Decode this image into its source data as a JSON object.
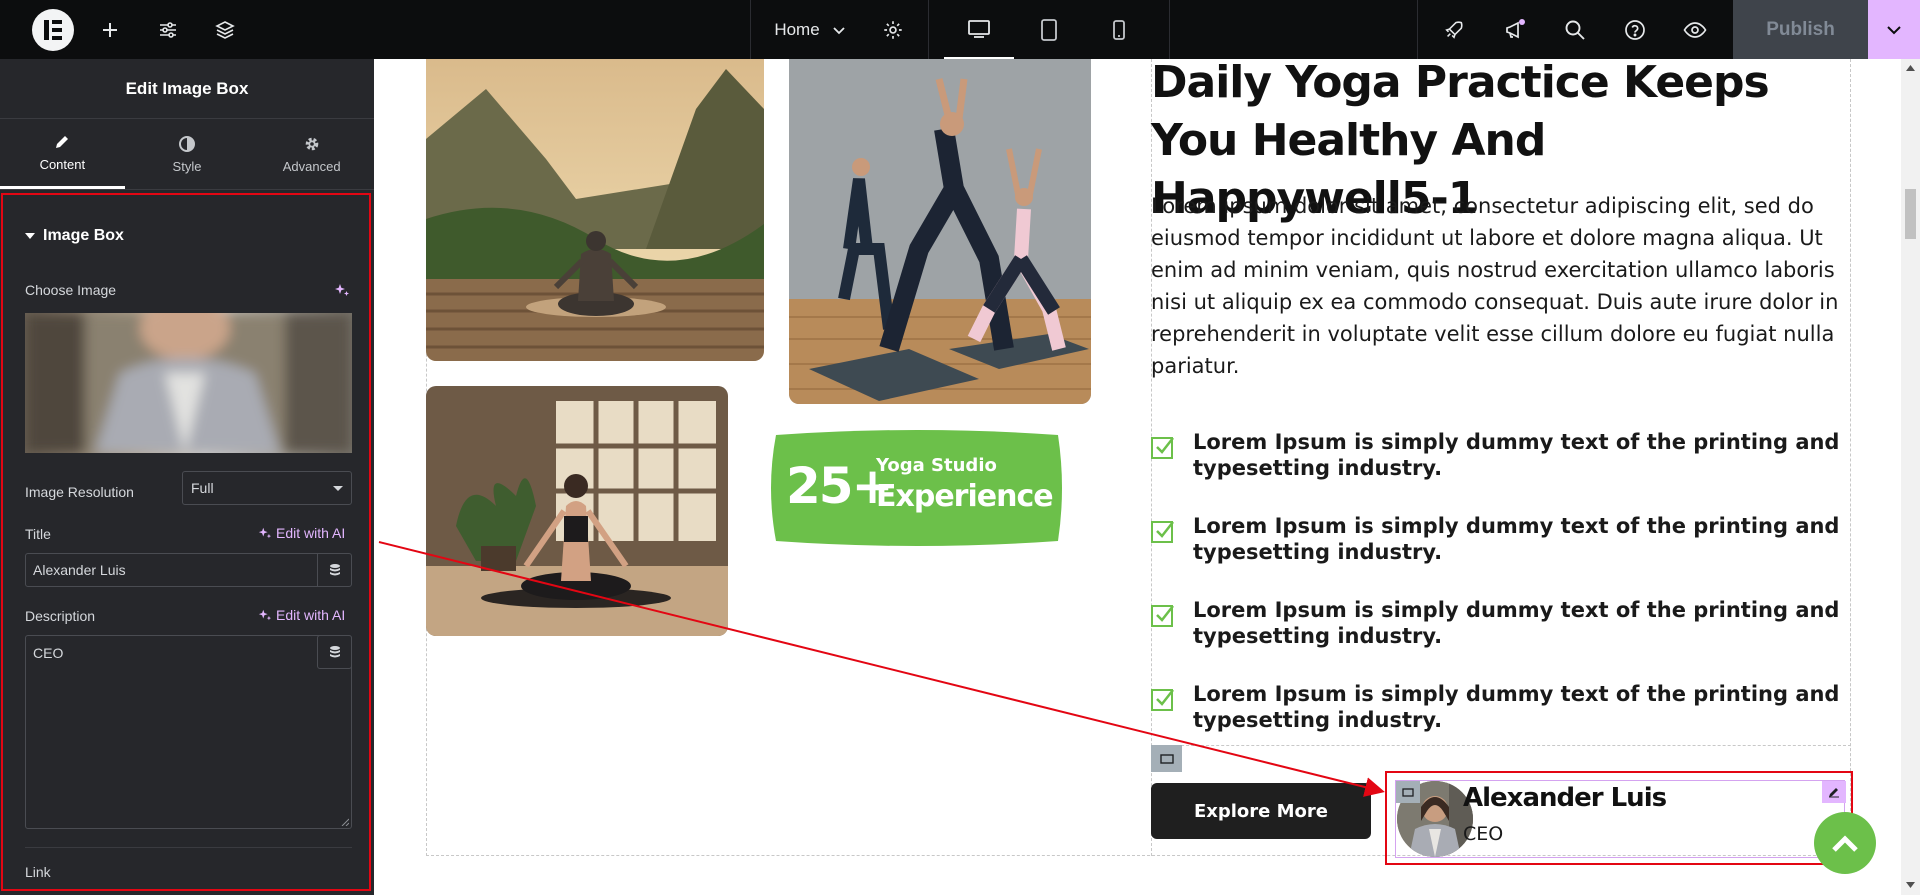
{
  "topbar": {
    "page_name": "Home",
    "publish_label": "Publish"
  },
  "panel": {
    "title": "Edit Image Box",
    "tabs": [
      {
        "label": "Content"
      },
      {
        "label": "Style"
      },
      {
        "label": "Advanced"
      }
    ],
    "section_title": "Image Box",
    "choose_image_label": "Choose Image",
    "image_resolution_label": "Image Resolution",
    "image_resolution_value": "Full",
    "title_label": "Title",
    "title_value": "Alexander Luis",
    "description_label": "Description",
    "description_value": "CEO",
    "edit_ai_label": "Edit with AI",
    "link_label": "Link"
  },
  "content": {
    "heading": "Daily Yoga Practice Keeps You Healthy And Happywell5-1",
    "paragraph": "Lorem ipsum dolor sit amet, consectetur adipiscing elit, sed do eiusmod tempor incididunt ut labore et dolore magna aliqua. Ut enim ad minim veniam, quis nostrud exercitation ullamco laboris nisi ut aliquip ex ea commodo consequat. Duis aute irure dolor in reprehenderit in voluptate velit esse cillum dolore eu fugiat nulla pariatur.",
    "list": [
      "Lorem Ipsum is simply dummy text of the printing and typesetting industry.",
      "Lorem Ipsum is simply dummy text of the printing and typesetting industry.",
      "Lorem Ipsum is simply dummy text of the printing and typesetting industry.",
      "Lorem Ipsum is simply dummy text of the printing and typesetting industry."
    ],
    "badge": {
      "number": "25+",
      "line1": "Yoga Studio",
      "line2": "Experience"
    },
    "explore_label": "Explore More",
    "person": {
      "name": "Alexander Luis",
      "role": "CEO"
    }
  },
  "colors": {
    "accent_green": "#6cc04a",
    "publish_pink": "#e3b6ff",
    "highlight_red": "#e30613"
  }
}
